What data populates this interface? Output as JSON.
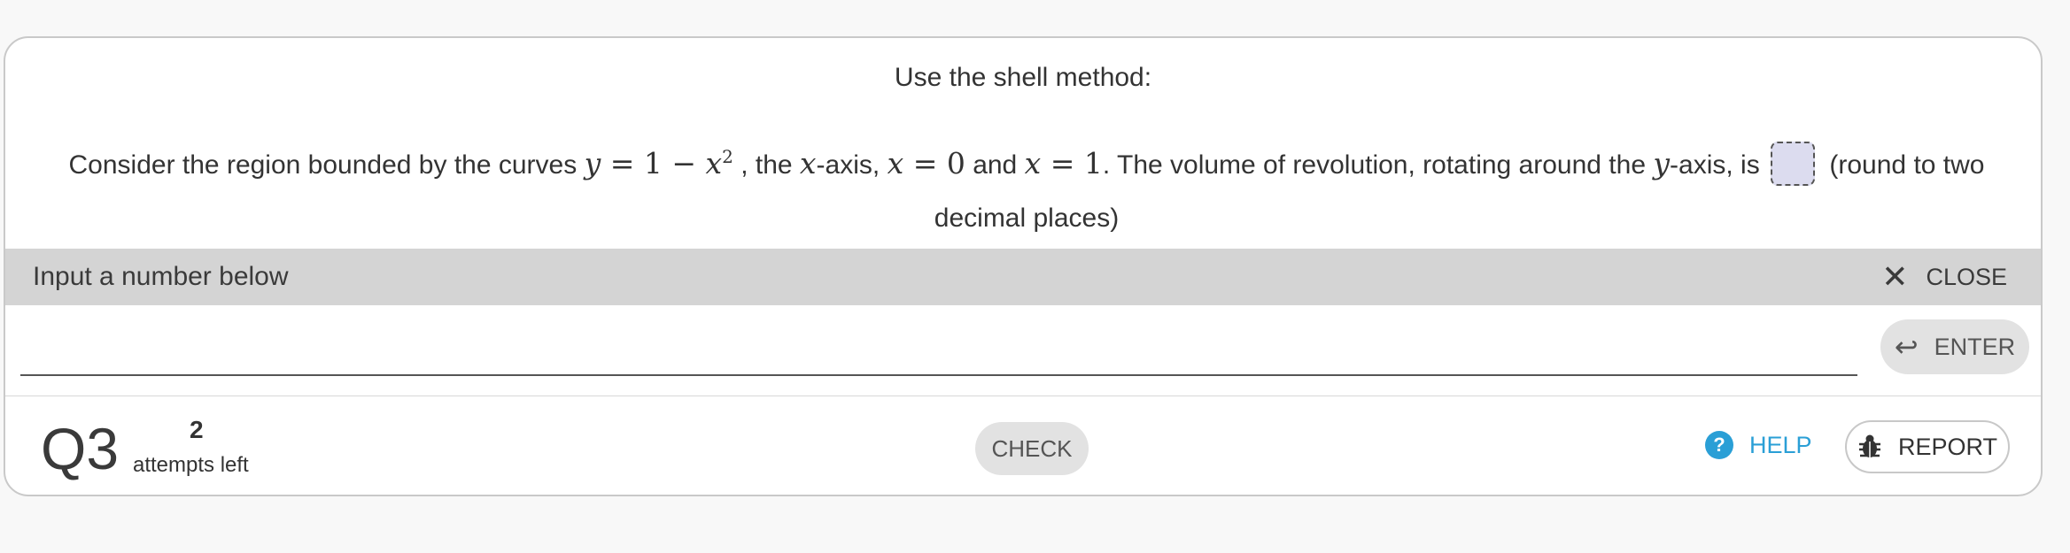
{
  "question": {
    "intro": "Use the shell method:",
    "text_part1": "Consider the region bounded by the curves",
    "math_curve": "y = 1 − x²",
    "text_part2": ", the",
    "math_x": "x",
    "text_part3": "-axis,",
    "math_x0": "x = 0",
    "text_part4": "and",
    "math_x1": "x = 1",
    "text_part5": ". The volume of revolution, rotating around the",
    "math_y": "y",
    "text_part6": "-axis, is",
    "text_part7": "(round to two decimal places)"
  },
  "input_panel": {
    "label": "Input a number below",
    "close_label": "CLOSE",
    "answer_value": "",
    "enter_label": "ENTER"
  },
  "footer": {
    "question_number": "Q3",
    "attempts_count": "2",
    "attempts_label": "attempts left",
    "check_label": "CHECK",
    "help_label": "HELP",
    "report_label": "REPORT"
  },
  "colors": {
    "accent": "#2a9fd6",
    "panel_bar": "#d4d4d4",
    "blank_fill": "#dcdcef"
  },
  "icons": [
    "close-icon",
    "enter-arrow-icon",
    "help-icon",
    "bug-icon"
  ]
}
